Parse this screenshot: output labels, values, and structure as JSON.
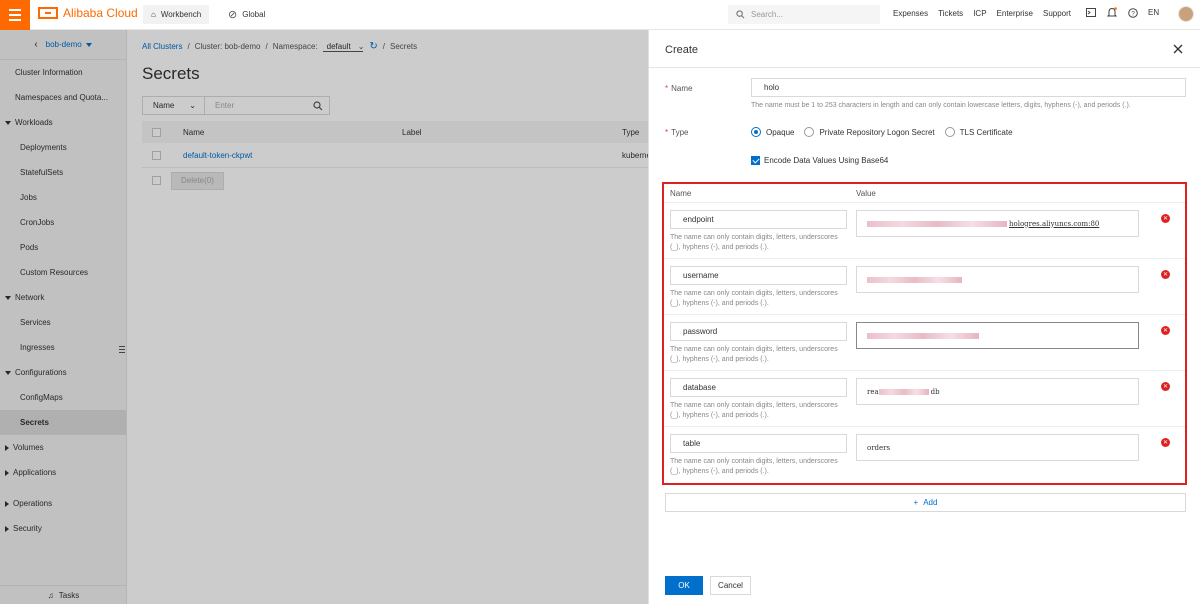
{
  "topbar": {
    "brand": "Alibaba Cloud",
    "workbench": "Workbench",
    "global": "Global",
    "search_placeholder": "Search...",
    "links": [
      "Expenses",
      "Tickets",
      "ICP",
      "Enterprise",
      "Support"
    ],
    "lang": "EN"
  },
  "sidebar": {
    "cluster": "bob-demo",
    "items": {
      "cluster_info": "Cluster Information",
      "namespaces": "Namespaces and Quota...",
      "workloads": "Workloads",
      "deployments": "Deployments",
      "statefulsets": "StatefulSets",
      "jobs": "Jobs",
      "cronjobs": "CronJobs",
      "pods": "Pods",
      "custom_resources": "Custom Resources",
      "network": "Network",
      "services": "Services",
      "ingresses": "Ingresses",
      "configurations": "Configurations",
      "configmaps": "ConfigMaps",
      "secrets": "Secrets",
      "volumes": "Volumes",
      "applications": "Applications",
      "operations": "Operations",
      "security": "Security"
    },
    "tasks": "Tasks"
  },
  "main": {
    "breadcrumb": {
      "all_clusters": "All Clusters",
      "cluster": "Cluster: bob-demo",
      "namespace_label": "Namespace:",
      "namespace_value": "default",
      "current": "Secrets"
    },
    "title": "Secrets",
    "filter": {
      "field": "Name",
      "placeholder": "Enter"
    },
    "table": {
      "headers": {
        "name": "Name",
        "label": "Label",
        "type": "Type"
      },
      "rows": [
        {
          "name": "default-token-ckpwt",
          "type": "kuberne"
        }
      ],
      "delete_label": "Delete(0)"
    }
  },
  "drawer": {
    "title": "Create",
    "name_label": "Name",
    "name_value": "holo",
    "name_hint": "The name must be 1 to 253 characters in length and can only contain lowercase letters, digits, hyphens (-), and periods (.).",
    "type_label": "Type",
    "type_options": [
      "Opaque",
      "Private Repository Logon Secret",
      "TLS Certificate"
    ],
    "type_selected": "Opaque",
    "encode_label": "Encode Data Values Using Base64",
    "encode_checked": true,
    "kv_headers": {
      "name": "Name",
      "value": "Value"
    },
    "key_hint": "The name can only contain digits, letters, underscores (_), hyphens (-), and periods (.).",
    "entries": [
      {
        "key": "endpoint",
        "value_visible": "hologres.aliyuncs.com:80"
      },
      {
        "key": "username",
        "value_visible": ""
      },
      {
        "key": "password",
        "value_visible": ""
      },
      {
        "key": "database",
        "value_visible_prefix": "rea",
        "value_visible": "db"
      },
      {
        "key": "table",
        "value_visible": "orders"
      }
    ],
    "add_label": "Add",
    "ok_label": "OK",
    "cancel_label": "Cancel"
  },
  "colors": {
    "accent": "#ff6a00",
    "link": "#0070cc",
    "highlight": "#e02020"
  }
}
